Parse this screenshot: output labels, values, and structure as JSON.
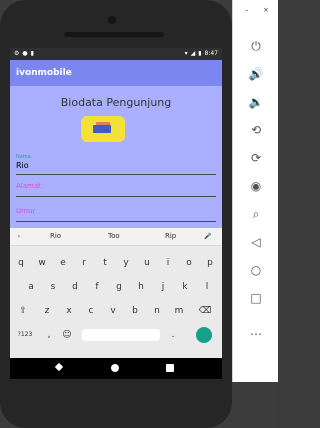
{
  "status": {
    "time": "8:47"
  },
  "app": {
    "title": "ivonmobile"
  },
  "page": {
    "heading": "Biodata Pengunjung",
    "name_label": "Nama",
    "name_value": "Rio",
    "address_hint": "Alamat",
    "age_hint": "Umur"
  },
  "keyboard": {
    "suggestions": [
      "Rio",
      "Too",
      "Rip"
    ],
    "row1": [
      "q",
      "w",
      "e",
      "r",
      "t",
      "y",
      "u",
      "i",
      "o",
      "p"
    ],
    "row2": [
      "a",
      "s",
      "d",
      "f",
      "g",
      "h",
      "j",
      "k",
      "l"
    ],
    "row3": [
      "z",
      "x",
      "c",
      "v",
      "b",
      "n",
      "m"
    ],
    "symbols": "?123"
  },
  "sidebar": {
    "min": "–",
    "close": "×"
  }
}
